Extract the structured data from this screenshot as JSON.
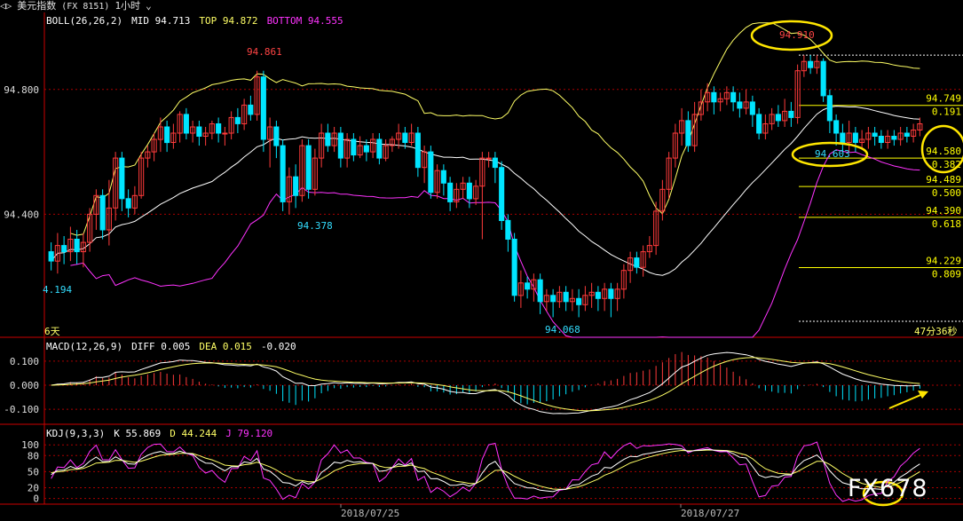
{
  "header": {
    "nav_icons": "◁▷",
    "title": "美元指数",
    "code": "(FX 8151)",
    "period": "1小时",
    "period_icon": "chevron-down-icon"
  },
  "boll": {
    "label": "BOLL(26,26,2)",
    "mid": "MID 94.713",
    "top": "TOP 94.872",
    "bottom": "BOTTOM 94.555"
  },
  "macd": {
    "label": "MACD(12,26,9)",
    "diff": "DIFF 0.005",
    "dea": "DEA 0.015",
    "macd": "-0.020"
  },
  "kdj": {
    "label": "KDJ(9,3,3)",
    "k": "K 55.869",
    "d": "D 44.244",
    "j": "J 79.120"
  },
  "notes": {
    "high_label": "94.910",
    "recent_low_label": "94.603",
    "left_high": "94.861",
    "mid_low": "94.378",
    "bottom_low": "94.068",
    "left_low": "4.194",
    "days_left": "6天",
    "countdown": "47分36秒"
  },
  "x_dates": [
    "2018/07/25",
    "2018/07/27"
  ],
  "watermark": "FX678",
  "colors": {
    "up": "#ff3b3b",
    "down": "#00e5ff",
    "mid": "#ffffff",
    "upper": "#ffff66",
    "lower": "#ff33ff",
    "fib": "#ffff00",
    "grid": "#aa0000",
    "circle": "#ffe600"
  },
  "chart_data": {
    "type": "candlestick",
    "main": {
      "ylim": [
        94.02,
        94.99
      ],
      "y_ticks": [
        94.4,
        94.8
      ],
      "y_tick_labels": [
        "94.400",
        "94.800"
      ],
      "fib_levels": [
        {
          "price": "94.910",
          "ratio": ""
        },
        {
          "price": "94.749",
          "ratio": "0.191"
        },
        {
          "price": "94.580",
          "ratio": "0.382"
        },
        {
          "price": "94.489",
          "ratio": "0.500"
        },
        {
          "price": "94.390",
          "ratio": "0.618"
        },
        {
          "price": "94.229",
          "ratio": "0.809"
        }
      ],
      "candles": [
        [
          94.28,
          94.25,
          94.31,
          94.22
        ],
        [
          94.25,
          94.3,
          94.34,
          94.21
        ],
        [
          94.3,
          94.28,
          94.33,
          94.24
        ],
        [
          94.28,
          94.32,
          94.36,
          94.25
        ],
        [
          94.32,
          94.28,
          94.35,
          94.24
        ],
        [
          94.28,
          94.31,
          94.34,
          94.23
        ],
        [
          94.31,
          94.4,
          94.42,
          94.28
        ],
        [
          94.4,
          94.46,
          94.48,
          94.35
        ],
        [
          94.46,
          94.35,
          94.48,
          94.32
        ],
        [
          94.35,
          94.42,
          94.51,
          94.3
        ],
        [
          94.42,
          94.58,
          94.6,
          94.38
        ],
        [
          94.58,
          94.45,
          94.6,
          94.41
        ],
        [
          94.45,
          94.42,
          94.48,
          94.39
        ],
        [
          94.42,
          94.46,
          94.49,
          94.4
        ],
        [
          94.46,
          94.58,
          94.6,
          94.45
        ],
        [
          94.58,
          94.6,
          94.62,
          94.55
        ],
        [
          94.6,
          94.64,
          94.66,
          94.57
        ],
        [
          94.64,
          94.68,
          94.71,
          94.6
        ],
        [
          94.68,
          94.63,
          94.7,
          94.6
        ],
        [
          94.63,
          94.66,
          94.69,
          94.61
        ],
        [
          94.66,
          94.72,
          94.73,
          94.63
        ],
        [
          94.72,
          94.66,
          94.74,
          94.64
        ],
        [
          94.66,
          94.68,
          94.7,
          94.63
        ],
        [
          94.68,
          94.65,
          94.7,
          94.62
        ],
        [
          94.65,
          94.66,
          94.68,
          94.62
        ],
        [
          94.66,
          94.69,
          94.7,
          94.64
        ],
        [
          94.69,
          94.66,
          94.71,
          94.63
        ],
        [
          94.66,
          94.66,
          94.68,
          94.62
        ],
        [
          94.66,
          94.71,
          94.73,
          94.64
        ],
        [
          94.71,
          94.69,
          94.74,
          94.66
        ],
        [
          94.69,
          94.75,
          94.77,
          94.67
        ],
        [
          94.75,
          94.72,
          94.78,
          94.7
        ],
        [
          94.72,
          94.84,
          94.86,
          94.7
        ],
        [
          94.84,
          94.64,
          94.86,
          94.6
        ],
        [
          94.64,
          94.68,
          94.71,
          94.55
        ],
        [
          94.68,
          94.62,
          94.7,
          94.58
        ],
        [
          94.62,
          94.44,
          94.64,
          94.41
        ],
        [
          94.44,
          94.52,
          94.55,
          94.4
        ],
        [
          94.52,
          94.46,
          94.56,
          94.42
        ],
        [
          94.46,
          94.62,
          94.64,
          94.44
        ],
        [
          94.62,
          94.48,
          94.64,
          94.45
        ],
        [
          94.48,
          94.58,
          94.61,
          94.46
        ],
        [
          94.58,
          94.66,
          94.69,
          94.55
        ],
        [
          94.66,
          94.62,
          94.69,
          94.6
        ],
        [
          94.62,
          94.66,
          94.68,
          94.6
        ],
        [
          94.66,
          94.58,
          94.68,
          94.55
        ],
        [
          94.58,
          94.64,
          94.66,
          94.55
        ],
        [
          94.64,
          94.59,
          94.66,
          94.57
        ],
        [
          94.59,
          94.62,
          94.65,
          94.58
        ],
        [
          94.62,
          94.6,
          94.64,
          94.57
        ],
        [
          94.6,
          94.64,
          94.66,
          94.58
        ],
        [
          94.64,
          94.58,
          94.66,
          94.56
        ],
        [
          94.58,
          94.62,
          94.64,
          94.57
        ],
        [
          94.62,
          94.64,
          94.65,
          94.6
        ],
        [
          94.64,
          94.66,
          94.69,
          94.61
        ],
        [
          94.66,
          94.63,
          94.68,
          94.61
        ],
        [
          94.63,
          94.66,
          94.69,
          94.62
        ],
        [
          94.66,
          94.55,
          94.68,
          94.52
        ],
        [
          94.55,
          94.6,
          94.62,
          94.5
        ],
        [
          94.6,
          94.47,
          94.62,
          94.45
        ],
        [
          94.47,
          94.54,
          94.56,
          94.45
        ],
        [
          94.54,
          94.5,
          94.56,
          94.46
        ],
        [
          94.5,
          94.44,
          94.52,
          94.41
        ],
        [
          94.44,
          94.48,
          94.5,
          94.42
        ],
        [
          94.48,
          94.5,
          94.52,
          94.45
        ],
        [
          94.5,
          94.45,
          94.52,
          94.42
        ],
        [
          94.45,
          94.49,
          94.51,
          94.43
        ],
        [
          94.49,
          94.58,
          94.6,
          94.32
        ],
        [
          94.58,
          94.58,
          94.6,
          94.55
        ],
        [
          94.58,
          94.55,
          94.6,
          94.5
        ],
        [
          94.55,
          94.38,
          94.57,
          94.35
        ],
        [
          94.38,
          94.32,
          94.4,
          94.28
        ],
        [
          94.32,
          94.14,
          94.34,
          94.12
        ],
        [
          94.14,
          94.18,
          94.22,
          94.1
        ],
        [
          94.18,
          94.16,
          94.2,
          94.13
        ],
        [
          94.16,
          94.19,
          94.21,
          94.12
        ],
        [
          94.19,
          94.12,
          94.21,
          94.08
        ],
        [
          94.12,
          94.14,
          94.16,
          94.09
        ],
        [
          94.14,
          94.12,
          94.16,
          94.07
        ],
        [
          94.12,
          94.15,
          94.17,
          94.1
        ],
        [
          94.15,
          94.12,
          94.17,
          94.09
        ],
        [
          94.12,
          94.13,
          94.16,
          94.09
        ],
        [
          94.13,
          94.11,
          94.16,
          94.07
        ],
        [
          94.11,
          94.14,
          94.17,
          94.09
        ],
        [
          94.14,
          94.15,
          94.18,
          94.1
        ],
        [
          94.15,
          94.13,
          94.17,
          94.09
        ],
        [
          94.13,
          94.16,
          94.18,
          94.09
        ],
        [
          94.16,
          94.13,
          94.18,
          94.07
        ],
        [
          94.13,
          94.16,
          94.18,
          94.09
        ],
        [
          94.16,
          94.22,
          94.24,
          94.13
        ],
        [
          94.22,
          94.26,
          94.28,
          94.18
        ],
        [
          94.26,
          94.23,
          94.28,
          94.21
        ],
        [
          94.23,
          94.28,
          94.3,
          94.2
        ],
        [
          94.28,
          94.3,
          94.33,
          94.26
        ],
        [
          94.3,
          94.41,
          94.44,
          94.27
        ],
        [
          94.41,
          94.48,
          94.51,
          94.38
        ],
        [
          94.48,
          94.58,
          94.6,
          94.45
        ],
        [
          94.58,
          94.66,
          94.69,
          94.55
        ],
        [
          94.66,
          94.7,
          94.74,
          94.62
        ],
        [
          94.7,
          94.62,
          94.73,
          94.6
        ],
        [
          94.62,
          94.72,
          94.76,
          94.6
        ],
        [
          94.72,
          94.76,
          94.8,
          94.7
        ],
        [
          94.76,
          94.79,
          94.82,
          94.73
        ],
        [
          94.79,
          94.76,
          94.81,
          94.72
        ],
        [
          94.76,
          94.77,
          94.79,
          94.73
        ],
        [
          94.77,
          94.79,
          94.81,
          94.75
        ],
        [
          94.79,
          94.76,
          94.81,
          94.73
        ],
        [
          94.76,
          94.74,
          94.79,
          94.71
        ],
        [
          94.74,
          94.76,
          94.8,
          94.72
        ],
        [
          94.76,
          94.72,
          94.78,
          94.68
        ],
        [
          94.72,
          94.66,
          94.74,
          94.64
        ],
        [
          94.66,
          94.69,
          94.72,
          94.64
        ],
        [
          94.69,
          94.72,
          94.74,
          94.67
        ],
        [
          94.72,
          94.7,
          94.75,
          94.68
        ],
        [
          94.7,
          94.73,
          94.77,
          94.68
        ],
        [
          94.73,
          94.71,
          94.76,
          94.68
        ],
        [
          94.71,
          94.86,
          94.88,
          94.69
        ],
        [
          94.86,
          94.89,
          94.91,
          94.84
        ],
        [
          94.89,
          94.87,
          94.91,
          94.85
        ],
        [
          94.87,
          94.89,
          94.91,
          94.85
        ],
        [
          94.89,
          94.78,
          94.9,
          94.76
        ],
        [
          94.78,
          94.7,
          94.8,
          94.66
        ],
        [
          94.7,
          94.66,
          94.72,
          94.62
        ],
        [
          94.66,
          94.63,
          94.69,
          94.6
        ],
        [
          94.63,
          94.66,
          94.7,
          94.6
        ],
        [
          94.66,
          94.63,
          94.68,
          94.6
        ],
        [
          94.63,
          94.64,
          94.67,
          94.61
        ],
        [
          94.64,
          94.66,
          94.68,
          94.61
        ],
        [
          94.66,
          94.65,
          94.68,
          94.62
        ],
        [
          94.65,
          94.63,
          94.67,
          94.61
        ],
        [
          94.63,
          94.65,
          94.67,
          94.61
        ],
        [
          94.65,
          94.64,
          94.67,
          94.62
        ],
        [
          94.64,
          94.66,
          94.68,
          94.62
        ],
        [
          94.66,
          94.65,
          94.68,
          94.63
        ],
        [
          94.65,
          94.67,
          94.69,
          94.63
        ],
        [
          94.67,
          94.69,
          94.71,
          94.65
        ]
      ]
    },
    "macd_panel": {
      "ylim": [
        -0.14,
        0.14
      ],
      "y_ticks": [
        0.1,
        0.0,
        -0.1
      ],
      "y_tick_labels": [
        "0.100",
        "0.000",
        "-0.100"
      ]
    },
    "kdj_panel": {
      "ylim": [
        -4,
        112
      ],
      "y_ticks": [
        100,
        80,
        50,
        20,
        0
      ],
      "y_tick_labels": [
        "100",
        "80",
        "50",
        "20",
        "0"
      ]
    }
  }
}
